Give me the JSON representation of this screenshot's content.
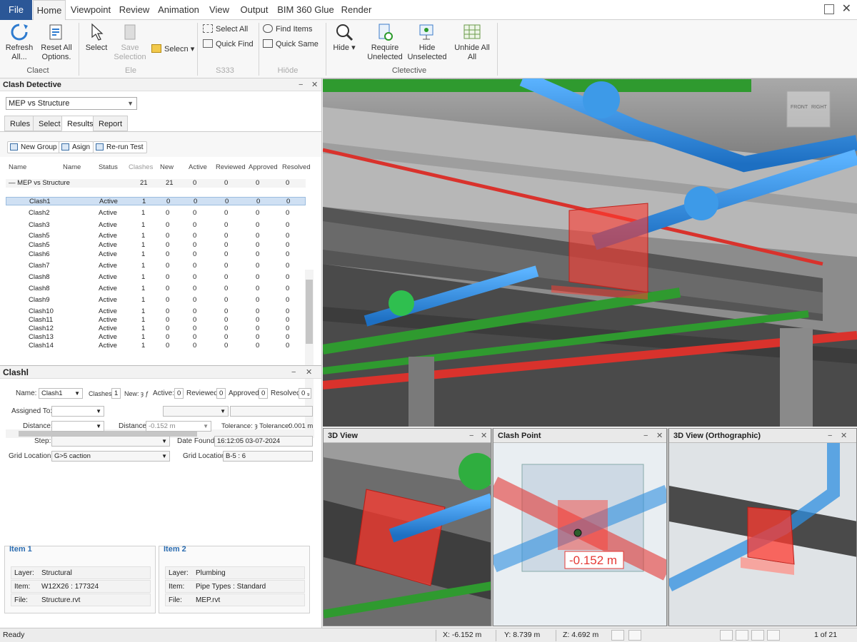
{
  "menu": {
    "file": "File",
    "tabs": [
      "Home",
      "Viewpoint",
      "Review",
      "Animation",
      "View",
      "Output",
      "BIM 360 Glue",
      "Render"
    ]
  },
  "ribbon": {
    "refresh": "Refresh All...",
    "reset_all": "Reset All Options.",
    "select": "Select",
    "save_selection": "Save Selection",
    "selecn": "Selecn",
    "select_all": "Select All",
    "quick_find": "Quick Find",
    "find_items": "Find Items",
    "quick_same": "Quick Same",
    "hide": "Hide",
    "require_unselected": "Require Unelected",
    "hide_unselected": "Hide Unselected",
    "unhide_all": "Unhide All All",
    "groups": {
      "claect": "Claect",
      "ele": "Ele",
      "s333": "S333",
      "hiode": "Hiōde",
      "cletective": "Cletective"
    }
  },
  "clash_detective": {
    "title": "Clash Detective",
    "test_name": "MEP vs Structure",
    "tabs": [
      "Rules",
      "Select",
      "Results",
      "Report"
    ],
    "active_tab": "Results",
    "buttons": {
      "new_group": "New Group",
      "assign": "Asign",
      "rerun": "Re-run Test"
    },
    "columns": [
      "Name",
      "Name",
      "Status",
      "Clashes",
      "New",
      "Active",
      "Reviewed",
      "Approved",
      "Resolved"
    ],
    "group_row": {
      "name": "MEP vs Structure",
      "clashes": "21",
      "new": "21",
      "active": "0",
      "reviewed": "0",
      "approved": "0",
      "resolved": "0"
    },
    "rows": [
      {
        "name": "Clash1",
        "status": "Active",
        "clashes": "1",
        "new": "0",
        "active": "0",
        "reviewed": "0",
        "approved": "0",
        "resolved": "0"
      },
      {
        "name": "Clash2",
        "status": "Active",
        "clashes": "1",
        "new": "0",
        "active": "0",
        "reviewed": "0",
        "approved": "0",
        "resolved": "0"
      },
      {
        "name": "Clash3",
        "status": "Active",
        "clashes": "1",
        "new": "0",
        "active": "0",
        "reviewed": "0",
        "approved": "0",
        "resolved": "0"
      },
      {
        "name": "Clash5",
        "status": "Active",
        "clashes": "1",
        "new": "0",
        "active": "0",
        "reviewed": "0",
        "approved": "0",
        "resolved": "0"
      },
      {
        "name": "Clash5",
        "status": "Active",
        "clashes": "1",
        "new": "0",
        "active": "0",
        "reviewed": "0",
        "approved": "0",
        "resolved": "0"
      },
      {
        "name": "Clash6",
        "status": "Active",
        "clashes": "1",
        "new": "0",
        "active": "0",
        "reviewed": "0",
        "approved": "0",
        "resolved": "0"
      },
      {
        "name": "Clash7",
        "status": "Active",
        "clashes": "1",
        "new": "0",
        "active": "0",
        "reviewed": "0",
        "approved": "0",
        "resolved": "0"
      },
      {
        "name": "Clash8",
        "status": "Active",
        "clashes": "1",
        "new": "0",
        "active": "0",
        "reviewed": "0",
        "approved": "0",
        "resolved": "0"
      },
      {
        "name": "Clash8",
        "status": "Active",
        "clashes": "1",
        "new": "0",
        "active": "0",
        "reviewed": "0",
        "approved": "0",
        "resolved": "0"
      },
      {
        "name": "Clash9",
        "status": "Active",
        "clashes": "1",
        "new": "0",
        "active": "0",
        "reviewed": "0",
        "approved": "0",
        "resolved": "0"
      },
      {
        "name": "Clash10",
        "status": "Active",
        "clashes": "1",
        "new": "0",
        "active": "0",
        "reviewed": "0",
        "approved": "0",
        "resolved": "0"
      },
      {
        "name": "Clash11",
        "status": "Active",
        "clashes": "1",
        "new": "0",
        "active": "0",
        "reviewed": "0",
        "approved": "0",
        "resolved": "0"
      },
      {
        "name": "Clash12",
        "status": "Active",
        "clashes": "1",
        "new": "0",
        "active": "0",
        "reviewed": "0",
        "approved": "0",
        "resolved": "0"
      },
      {
        "name": "Clash13",
        "status": "Active",
        "clashes": "1",
        "new": "0",
        "active": "0",
        "reviewed": "0",
        "approved": "0",
        "resolved": "0"
      },
      {
        "name": "Clash14",
        "status": "Active",
        "clashes": "1",
        "new": "0",
        "active": "0",
        "reviewed": "0",
        "approved": "0",
        "resolved": "0"
      }
    ]
  },
  "clash_detail": {
    "title": "Clashl",
    "name_label": "Name:",
    "name_value": "Clash1",
    "clashes_label": "Clashes:",
    "clashes_value": "1",
    "new_label": "New: ȝ ƒ",
    "active_label": "Active:",
    "active_value": "0",
    "reviewed_label": "Reviewed:",
    "reviewed_value": "0",
    "approved_label": "Approved:",
    "approved_value": "0",
    "resolved_label": "Resolved:",
    "resolved_value": "0 ₉",
    "assigned_label": "Assigned To:",
    "distance_label": "Distance:",
    "distance2_label": "Distance:",
    "distance2_value": "-0.152 m",
    "tolerance_label": "Tolerance: ȝ Tolerance:",
    "tolerance_value": "0.001 m",
    "step_label": "Step:",
    "date_label": "Date Found:",
    "date_value": "16:12:05 03-07-2024",
    "grid_label": "Grid Location:",
    "grid_value": "G>5 caction",
    "grid2_label": "Grid Location:",
    "grid2_value": "B-5 : 6",
    "item1": {
      "title": "Item 1",
      "layer_label": "Layer:",
      "layer": "Structural",
      "item_label": "Item:",
      "item": "W12X26 : 177324",
      "file_label": "File:",
      "file": "Structure.rvt"
    },
    "item2": {
      "title": "Item 2",
      "layer_label": "Layer:",
      "layer": "Plumbing",
      "item_label": "Item:",
      "item": "Pipe Types : Standard",
      "file_label": "File:",
      "file": "MEP.rvt"
    }
  },
  "viewcube": {
    "front": "FRONT",
    "right": "RIGHT"
  },
  "views": {
    "v1_title": "3D View",
    "v2_title": "Clash Point",
    "v2_distance": "-0.152 m",
    "v3_title": "3D View (Orthographic)"
  },
  "status": {
    "ready": "Ready",
    "x": "X: -6.152 m",
    "y": "Y: 8.739 m",
    "z": "Z: 4.692 m",
    "page": "1 of 21"
  },
  "colors": {
    "accent": "#2b5797",
    "clash_red": "#e53935",
    "pipe_blue": "#2f8fe0",
    "pipe_green": "#3aa83a"
  }
}
